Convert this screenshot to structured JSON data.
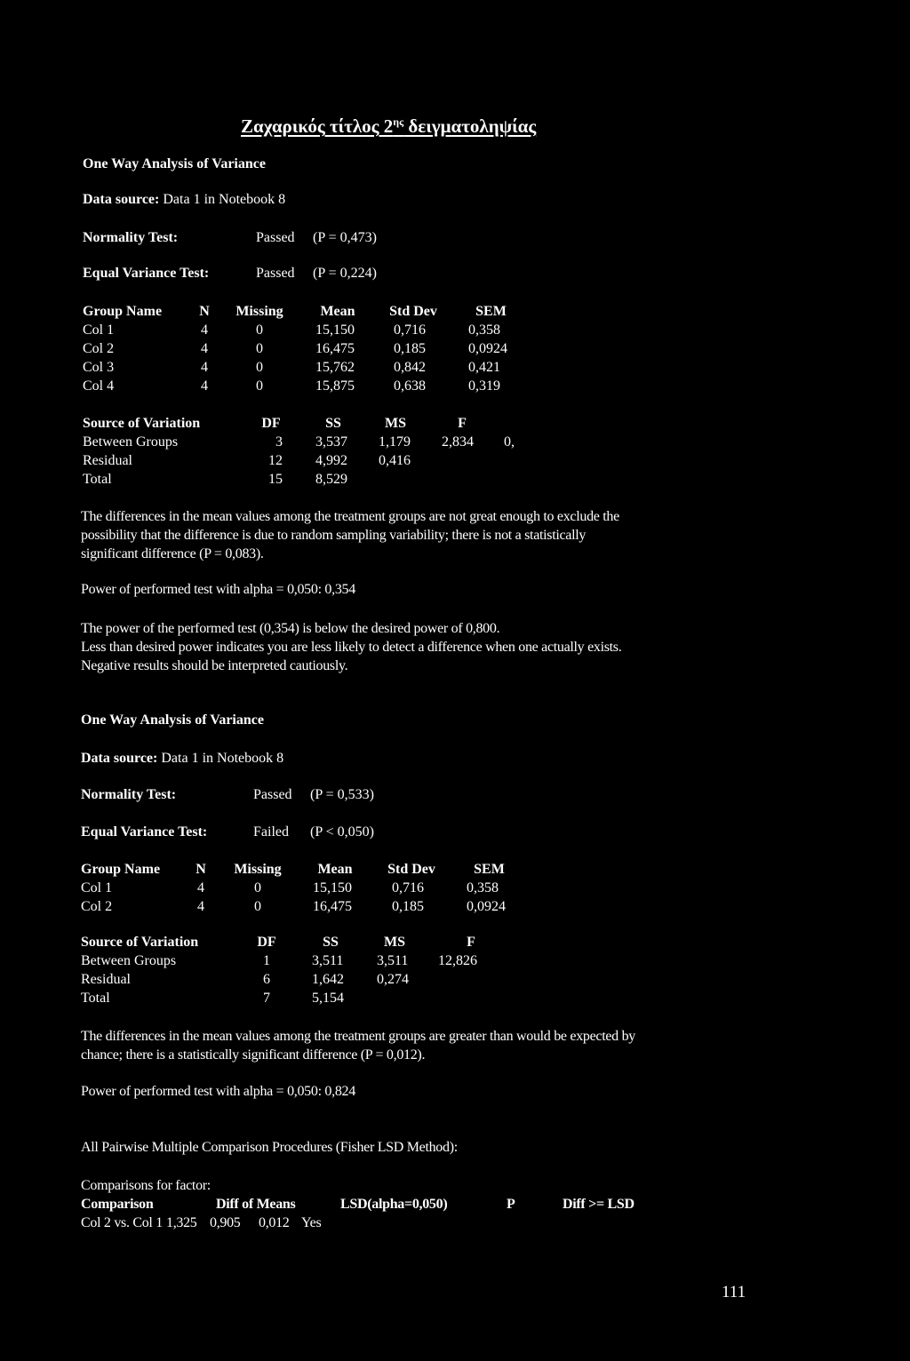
{
  "title": {
    "main": "Ζαχαρικός τίτλος 2",
    "sup": "ης",
    "rest": " δειγματοληψίας"
  },
  "analysis1": {
    "heading": "One Way Analysis of Variance",
    "data_source_label": "Data source:",
    "data_source_value": "Data 1 in Notebook 8",
    "normality_label": "Normality Test:",
    "normality_result": "Passed",
    "normality_p": "(P = 0,473)",
    "equal_var_label": "Equal Variance Test:",
    "equal_var_result": "Passed",
    "equal_var_p": "(P = 0,224)",
    "groups_header": [
      "Group Name",
      "N",
      "Missing",
      "Mean",
      "Std Dev",
      "SEM"
    ],
    "groups": [
      [
        "Col 1",
        "4",
        "0",
        "15,150",
        "0,716",
        "0,358"
      ],
      [
        "Col 2",
        "4",
        "0",
        "16,475",
        "0,185",
        "0,0924"
      ],
      [
        "Col 3",
        "4",
        "0",
        "15,762",
        "0,842",
        "0,421"
      ],
      [
        "Col 4",
        "4",
        "0",
        "15,875",
        "0,638",
        "0,319"
      ]
    ],
    "anova_header": [
      "Source of Variation",
      "DF",
      "SS",
      "MS",
      "F",
      ""
    ],
    "anova": [
      [
        "Between Groups",
        "3",
        "3,537",
        "1,179",
        "2,834",
        "0,"
      ],
      [
        "Residual",
        "12",
        "4,992",
        "0,416",
        "",
        ""
      ],
      [
        "Total",
        "15",
        "8,529",
        "",
        "",
        ""
      ]
    ],
    "conclusion_lines": [
      "The differences in the mean values among the treatment groups are not great enough to exclude the",
      "possibility that the difference is due to random sampling variability; there is not a statistically",
      "significant difference  (P = 0,083)."
    ],
    "power": "Power of performed test with alpha = 0,050: 0,354",
    "power_note_lines": [
      "The power of the performed test (0,354) is below the desired power of 0,800.",
      "Less than desired power indicates you are less likely to detect a difference when one actually exists.",
      "Negative results should be interpreted cautiously."
    ]
  },
  "analysis2": {
    "heading": "One Way Analysis of Variance",
    "data_source_label": "Data source:",
    "data_source_value": "Data 1 in Notebook 8",
    "normality_label": "Normality Test:",
    "normality_result": "Passed",
    "normality_p": "(P = 0,533)",
    "equal_var_label": "Equal Variance Test:",
    "equal_var_result": "Failed",
    "equal_var_p": "(P < 0,050)",
    "groups_header": [
      "Group Name",
      "N",
      "Missing",
      "Mean",
      "Std Dev",
      "SEM"
    ],
    "groups": [
      [
        "Col 1",
        "4",
        "0",
        "15,150",
        "0,716",
        "0,358"
      ],
      [
        "Col 2",
        "4",
        "0",
        "16,475",
        "0,185",
        "0,0924"
      ]
    ],
    "anova_header": [
      "Source of Variation",
      "DF",
      "SS",
      "MS",
      "F"
    ],
    "anova": [
      [
        "Between Groups",
        "1",
        "3,511",
        "3,511",
        "12,826"
      ],
      [
        "Residual",
        "6",
        "1,642",
        "0,274",
        ""
      ],
      [
        "Total",
        "7",
        "5,154",
        "",
        ""
      ]
    ],
    "conclusion_lines": [
      "The differences in the mean values among the treatment groups are greater than would be expected by",
      "chance; there is a statistically significant difference  (P = 0,012)."
    ],
    "power": "Power of performed test with alpha = 0,050: 0,824",
    "pairwise_heading": "All Pairwise Multiple Comparison Procedures (Fisher LSD Method):",
    "comparisons_label": "Comparisons for factor:",
    "comparison_header": [
      "Comparison",
      "Diff of Means",
      "LSD(alpha=0,050)",
      "P",
      "Diff >= LSD"
    ],
    "comparison_rows": [
      [
        "Col 2 vs. Col 1",
        "1,325",
        "0,905",
        "0,012",
        "Yes"
      ]
    ]
  },
  "page_number": "111"
}
